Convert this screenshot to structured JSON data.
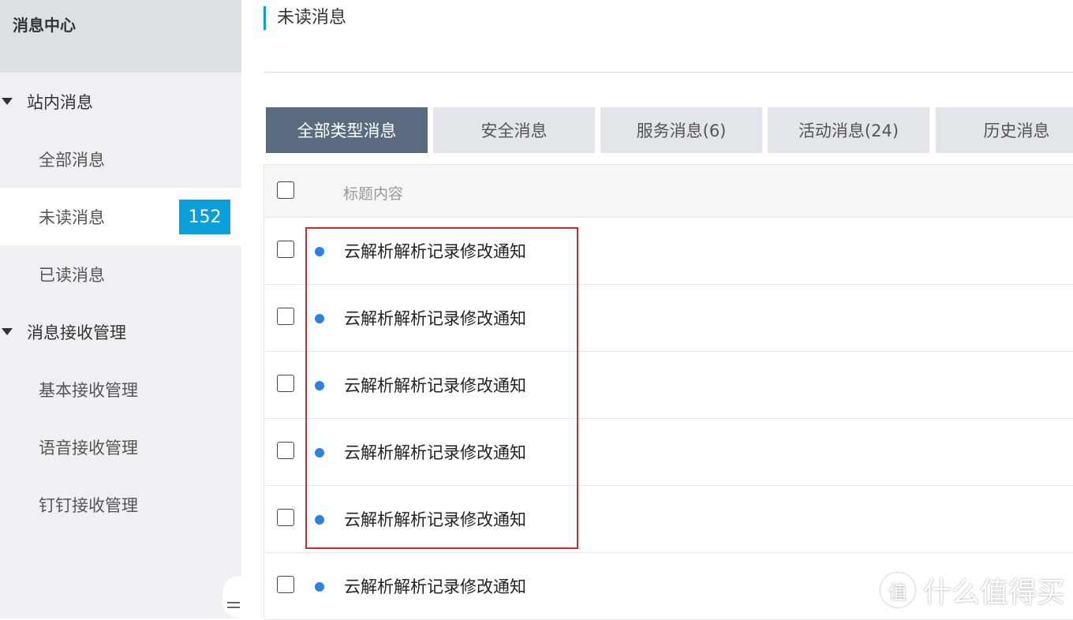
{
  "sidebar": {
    "title": "消息中心",
    "groups": [
      {
        "label": "站内消息",
        "items": [
          {
            "label": "全部消息"
          },
          {
            "label": "未读消息",
            "badge": "152"
          },
          {
            "label": "已读消息"
          }
        ]
      },
      {
        "label": "消息接收管理",
        "items": [
          {
            "label": "基本接收管理"
          },
          {
            "label": "语音接收管理"
          },
          {
            "label": "钉钉接收管理"
          }
        ]
      }
    ]
  },
  "page": {
    "title": "未读消息"
  },
  "tabs": [
    {
      "label": "全部类型消息",
      "active": true
    },
    {
      "label": "安全消息"
    },
    {
      "label": "服务消息(6)"
    },
    {
      "label": "活动消息(24)"
    },
    {
      "label": "历史消息"
    }
  ],
  "table": {
    "header": "标题内容",
    "rows": [
      {
        "title": "云解析解析记录修改通知"
      },
      {
        "title": "云解析解析记录修改通知"
      },
      {
        "title": "云解析解析记录修改通知"
      },
      {
        "title": "云解析解析记录修改通知"
      },
      {
        "title": "云解析解析记录修改通知"
      },
      {
        "title": "云解析解析记录修改通知"
      }
    ]
  },
  "colors": {
    "accent": "#0a9fd8",
    "tab_active": "#5b6b7f",
    "unread_dot": "#2b82e0",
    "highlight": "#d9262b"
  },
  "watermark": {
    "logo_glyph": "值",
    "text": "什么值得买"
  }
}
